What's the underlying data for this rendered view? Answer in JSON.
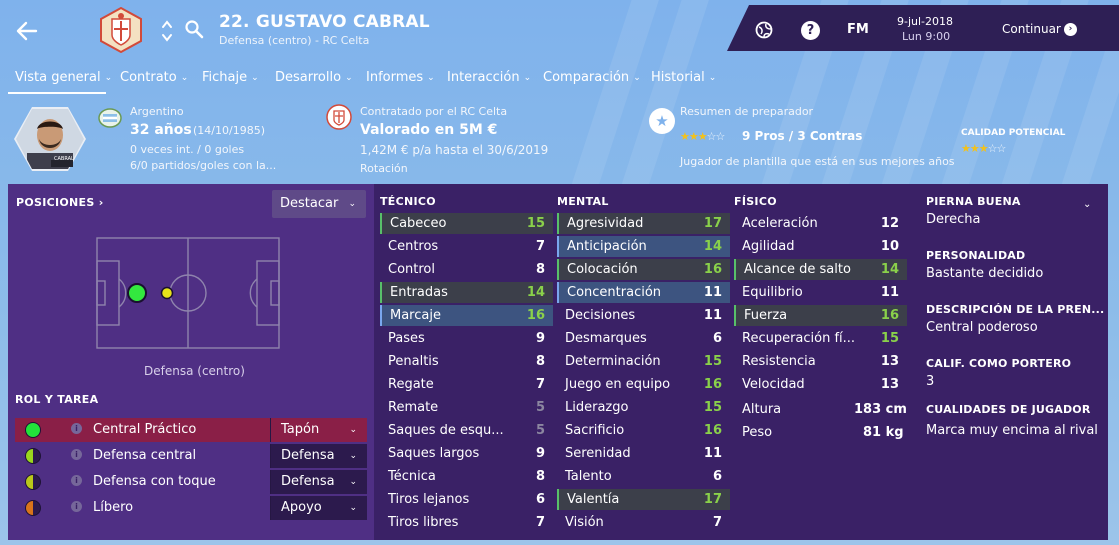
{
  "header": {
    "player_name": "22. GUSTAVO CABRAL",
    "player_sub": "Defensa (centro) - RC Celta",
    "fm_label": "FM",
    "date": "9-jul-2018",
    "day_time": "Lun 9:00",
    "continue_label": "Continuar"
  },
  "tabs": [
    {
      "label": "Vista general"
    },
    {
      "label": "Contrato"
    },
    {
      "label": "Fichaje"
    },
    {
      "label": "Desarrollo"
    },
    {
      "label": "Informes"
    },
    {
      "label": "Interacción"
    },
    {
      "label": "Comparación"
    },
    {
      "label": "Historial"
    }
  ],
  "info": {
    "nationality": "Argentino",
    "age": "32 años",
    "birth": "(14/10/1985)",
    "caps": "0 veces int. / 0 goles",
    "u21": "6/0 partidos/goles con la...",
    "contract_title": "Contratado por el RC Celta",
    "value": "Valorado en 5M €",
    "wage": "1,42M € p/a hasta el 30/6/2019",
    "status": "Rotación",
    "coach_title": "Resumen de preparador",
    "pros_cons": "9 Pros / 3 Contras",
    "coach_note": "Jugador de plantilla que está en sus mejores años",
    "potential_title": "CALIDAD POTENCIAL",
    "current_stars": 3,
    "potential_stars": 3,
    "avatar_caption": "CABRAL"
  },
  "positions": {
    "title": "POSICIONES",
    "highlight_label": "Destacar",
    "caption": "Defensa (centro)"
  },
  "roles": {
    "title": "ROL Y TAREA",
    "items": [
      {
        "name": "Central Práctico",
        "duty": "Tapón",
        "color": "#22e23a",
        "selected": true
      },
      {
        "name": "Defensa central",
        "duty": "Defensa",
        "color": "#9ad61e",
        "selected": false
      },
      {
        "name": "Defensa con toque",
        "duty": "Defensa",
        "color": "#b9c81a",
        "selected": false
      },
      {
        "name": "Líbero",
        "duty": "Apoyo",
        "color": "#d9741a",
        "selected": false
      }
    ]
  },
  "attributes": {
    "technical_title": "TÉCNICO",
    "mental_title": "MENTAL",
    "physical_title": "FÍSICO",
    "technical": [
      {
        "name": "Cabeceo",
        "value": "15"
      },
      {
        "name": "Centros",
        "value": "7"
      },
      {
        "name": "Control",
        "value": "8"
      },
      {
        "name": "Entradas",
        "value": "14"
      },
      {
        "name": "Marcaje",
        "value": "16"
      },
      {
        "name": "Pases",
        "value": "9"
      },
      {
        "name": "Penaltis",
        "value": "8"
      },
      {
        "name": "Regate",
        "value": "7"
      },
      {
        "name": "Remate",
        "value": "5"
      },
      {
        "name": "Saques de esqu...",
        "value": "5"
      },
      {
        "name": "Saques largos",
        "value": "9"
      },
      {
        "name": "Técnica",
        "value": "8"
      },
      {
        "name": "Tiros lejanos",
        "value": "6"
      },
      {
        "name": "Tiros libres",
        "value": "7"
      }
    ],
    "mental": [
      {
        "name": "Agresividad",
        "value": "17"
      },
      {
        "name": "Anticipación",
        "value": "14"
      },
      {
        "name": "Colocación",
        "value": "16"
      },
      {
        "name": "Concentración",
        "value": "11"
      },
      {
        "name": "Decisiones",
        "value": "11"
      },
      {
        "name": "Desmarques",
        "value": "6"
      },
      {
        "name": "Determinación",
        "value": "15"
      },
      {
        "name": "Juego en equipo",
        "value": "16"
      },
      {
        "name": "Liderazgo",
        "value": "15"
      },
      {
        "name": "Sacrificio",
        "value": "16"
      },
      {
        "name": "Serenidad",
        "value": "11"
      },
      {
        "name": "Talento",
        "value": "6"
      },
      {
        "name": "Valentía",
        "value": "17"
      },
      {
        "name": "Visión",
        "value": "7"
      }
    ],
    "physical": [
      {
        "name": "Aceleración",
        "value": "12"
      },
      {
        "name": "Agilidad",
        "value": "10"
      },
      {
        "name": "Alcance de salto",
        "value": "14"
      },
      {
        "name": "Equilibrio",
        "value": "11"
      },
      {
        "name": "Fuerza",
        "value": "16"
      },
      {
        "name": "Recuperación fí...",
        "value": "15"
      },
      {
        "name": "Resistencia",
        "value": "13"
      },
      {
        "name": "Velocidad",
        "value": "13"
      }
    ],
    "height_label": "Altura",
    "height_value": "183 cm",
    "weight_label": "Peso",
    "weight_value": "81 kg"
  },
  "details": {
    "foot_title": "PIERNA BUENA",
    "foot_value": "Derecha",
    "personality_title": "PERSONALIDAD",
    "personality_value": "Bastante decidido",
    "press_title": "DESCRIPCIÓN DE LA PREN...",
    "press_value": "Central poderoso",
    "gk_title": "CALIF. COMO PORTERO",
    "gk_value": "3",
    "traits_title": "CUALIDADES DE JUGADOR",
    "traits_value": "Marca muy encima al rival"
  },
  "colors": {
    "header_blue": "#7fb2ec",
    "panel_dark": "#3a2166",
    "panel_mid": "#4f2f84",
    "highlight_green": "#8ad14a",
    "selected_role": "#8a1f47"
  }
}
